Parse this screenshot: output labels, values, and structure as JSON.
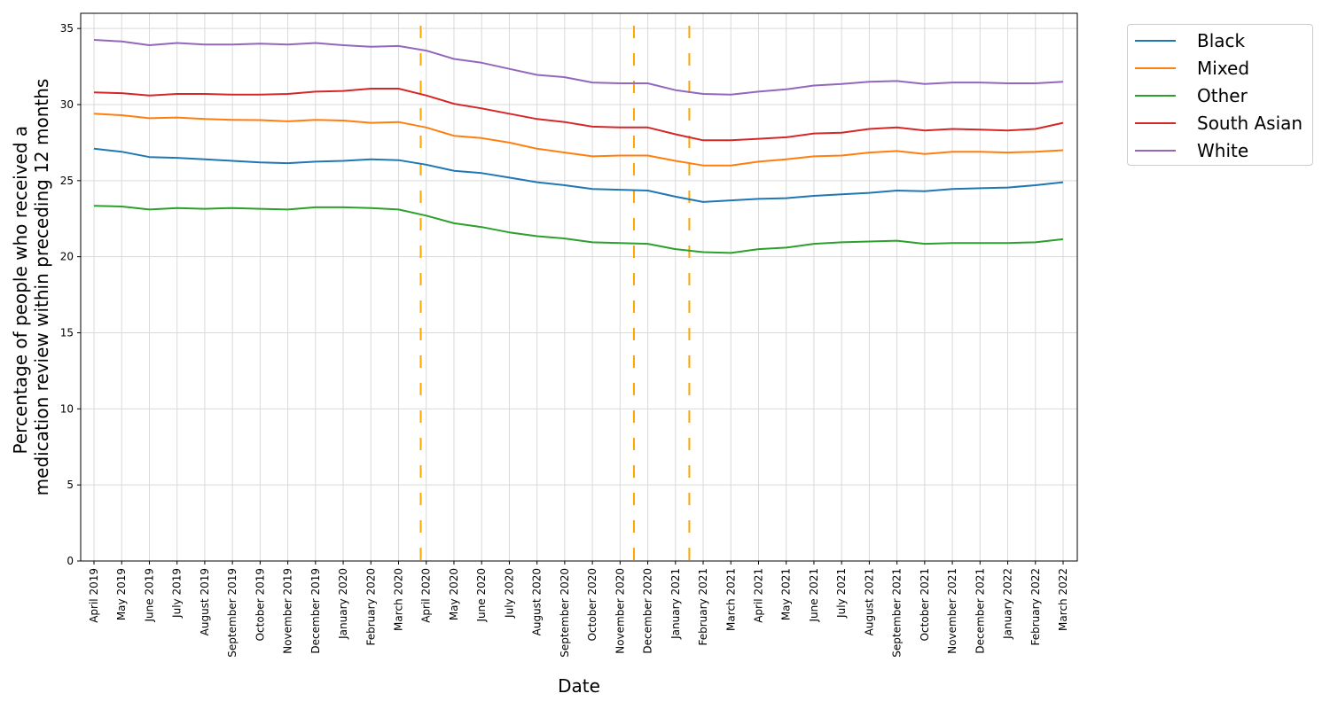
{
  "chart_data": {
    "type": "line",
    "title": "",
    "xlabel": "Date",
    "ylabel_lines": [
      "Percentage of people who received a",
      "medication review within preceding 12 months"
    ],
    "ylim": [
      0,
      36
    ],
    "yticks": [
      0,
      5,
      10,
      15,
      20,
      25,
      30,
      35
    ],
    "grid": true,
    "legend_placement": "outside-top-right",
    "x": [
      "April 2019",
      "May 2019",
      "June 2019",
      "July 2019",
      "August 2019",
      "September 2019",
      "October 2019",
      "November 2019",
      "December 2019",
      "January 2020",
      "February 2020",
      "March 2020",
      "April 2020",
      "May 2020",
      "June 2020",
      "July 2020",
      "August 2020",
      "September 2020",
      "October 2020",
      "November 2020",
      "December 2020",
      "January 2021",
      "February 2021",
      "March 2021",
      "April 2021",
      "May 2021",
      "June 2021",
      "July 2021",
      "August 2021",
      "September 2021",
      "October 2021",
      "November 2021",
      "December 2021",
      "January 2022",
      "February 2022",
      "March 2022"
    ],
    "series": [
      {
        "name": "Black",
        "color": "#1f77b4",
        "values": [
          27.1,
          26.9,
          26.55,
          26.5,
          26.4,
          26.3,
          26.2,
          26.15,
          26.25,
          26.3,
          26.4,
          26.35,
          26.05,
          25.65,
          25.5,
          25.2,
          24.9,
          24.7,
          24.45,
          24.4,
          24.35,
          23.95,
          23.6,
          23.7,
          23.8,
          23.85,
          24.0,
          24.1,
          24.2,
          24.35,
          24.3,
          24.45,
          24.5,
          24.55,
          24.7,
          24.9
        ]
      },
      {
        "name": "Mixed",
        "color": "#ff7f0e",
        "values": [
          29.4,
          29.3,
          29.1,
          29.15,
          29.05,
          29.0,
          28.98,
          28.9,
          29.0,
          28.95,
          28.8,
          28.85,
          28.5,
          27.95,
          27.8,
          27.5,
          27.1,
          26.85,
          26.6,
          26.65,
          26.65,
          26.3,
          26.0,
          26.0,
          26.25,
          26.4,
          26.6,
          26.65,
          26.85,
          26.95,
          26.75,
          26.9,
          26.9,
          26.85,
          26.9,
          27.0
        ]
      },
      {
        "name": "Other",
        "color": "#2ca02c",
        "values": [
          23.35,
          23.3,
          23.1,
          23.2,
          23.15,
          23.2,
          23.15,
          23.1,
          23.25,
          23.25,
          23.2,
          23.1,
          22.7,
          22.2,
          21.95,
          21.6,
          21.35,
          21.2,
          20.95,
          20.9,
          20.85,
          20.5,
          20.3,
          20.25,
          20.5,
          20.6,
          20.85,
          20.95,
          21.0,
          21.05,
          20.85,
          20.9,
          20.9,
          20.9,
          20.95,
          21.15
        ]
      },
      {
        "name": "South Asian",
        "color": "#d62728",
        "values": [
          30.8,
          30.75,
          30.6,
          30.7,
          30.7,
          30.65,
          30.65,
          30.7,
          30.85,
          30.9,
          31.05,
          31.05,
          30.6,
          30.05,
          29.75,
          29.4,
          29.05,
          28.85,
          28.55,
          28.5,
          28.5,
          28.05,
          27.65,
          27.65,
          27.75,
          27.85,
          28.1,
          28.15,
          28.4,
          28.5,
          28.3,
          28.4,
          28.35,
          28.3,
          28.4,
          28.8
        ]
      },
      {
        "name": "White",
        "color": "#9467bd",
        "values": [
          34.25,
          34.15,
          33.9,
          34.05,
          33.95,
          33.95,
          34.0,
          33.95,
          34.05,
          33.9,
          33.8,
          33.85,
          33.55,
          33.0,
          32.75,
          32.35,
          31.95,
          31.8,
          31.45,
          31.4,
          31.4,
          30.95,
          30.7,
          30.65,
          30.85,
          31.0,
          31.25,
          31.35,
          31.5,
          31.55,
          31.35,
          31.45,
          31.45,
          31.4,
          31.4,
          31.5
        ]
      }
    ],
    "vertical_markers": {
      "color": "#ffa500",
      "style": "dashed",
      "positions_month_index": [
        11.8,
        19.5,
        21.5
      ]
    }
  }
}
